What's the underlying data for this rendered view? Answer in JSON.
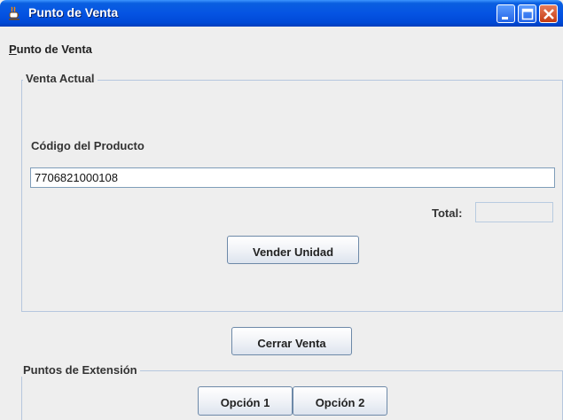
{
  "window": {
    "title": "Punto de Venta",
    "icon": "java-cup-icon"
  },
  "menubar": {
    "items": [
      {
        "label_mnemonic": "P",
        "label_rest": "unto de Venta"
      }
    ]
  },
  "venta_actual": {
    "legend": "Venta Actual",
    "product_code_label": "Código del Producto",
    "product_code_value": "7706821000108",
    "total_label": "Total:",
    "total_value": "",
    "sell_button": "Vender Unidad"
  },
  "close_sale_button": "Cerrar Venta",
  "extension_points": {
    "legend": "Puntos de Extensión",
    "option1": "Opción 1",
    "option2": "Opción 2"
  },
  "colors": {
    "title_bar": "#0554e3",
    "close_button": "#c53c13",
    "panel_bg": "#eeeeee",
    "group_border": "#b6c7de"
  }
}
